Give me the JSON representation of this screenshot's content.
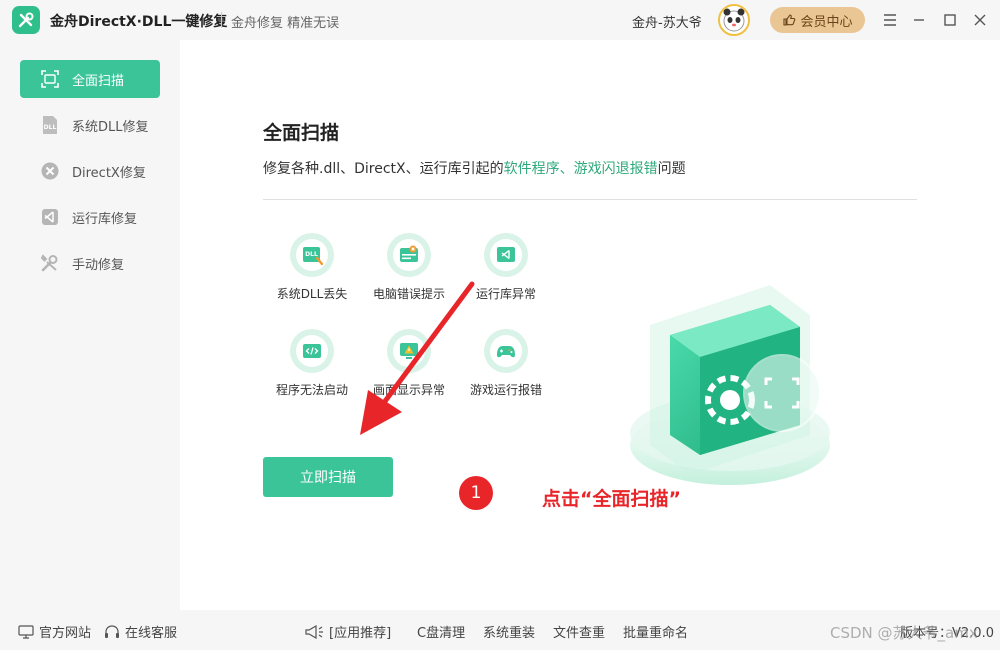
{
  "titlebar": {
    "app_title": "金舟DirectX·DLL一键修复",
    "slogan": "金舟修复 精准无误",
    "user_name": "金舟-苏大爷",
    "vip_label": "会员中心"
  },
  "sidebar": {
    "items": [
      {
        "label": "全面扫描",
        "icon": "scan-icon",
        "active": true
      },
      {
        "label": "系统DLL修复",
        "icon": "dll-icon",
        "active": false
      },
      {
        "label": "DirectX修复",
        "icon": "directx-icon",
        "active": false
      },
      {
        "label": "运行库修复",
        "icon": "runtime-icon",
        "active": false
      },
      {
        "label": "手动修复",
        "icon": "wrench-icon",
        "active": false
      }
    ]
  },
  "main": {
    "title": "全面扫描",
    "desc_prefix": "修复各种.dll、DirectX、运行库引起的",
    "desc_highlight": "软件程序、游戏闪退报错",
    "desc_suffix": "问题",
    "features": [
      {
        "label": "系统DLL丢失",
        "icon": "dll-file-icon"
      },
      {
        "label": "电脑错误提示",
        "icon": "error-window-icon"
      },
      {
        "label": "运行库异常",
        "icon": "runtime-window-icon"
      },
      {
        "label": "程序无法启动",
        "icon": "code-window-icon"
      },
      {
        "label": "画面显示异常",
        "icon": "warning-monitor-icon"
      },
      {
        "label": "游戏运行报错",
        "icon": "gamepad-icon"
      }
    ],
    "scan_button": "立即扫描"
  },
  "annotation": {
    "step_number": "1",
    "instruction": "点击“全面扫描”"
  },
  "bottombar": {
    "official_site": "官方网站",
    "online_service": "在线客服",
    "recommend": "[应用推荐]",
    "links": [
      "C盘清理",
      "系统重装",
      "文件查重",
      "批量重命名"
    ],
    "version": "版本号：V2.0.0",
    "watermark": "CSDN @苏大爷_amx"
  },
  "colors": {
    "accent": "#3ac497",
    "highlight_text": "#2fa97c",
    "annotation_red": "#e8262a",
    "vip_gold": "#e9c694"
  }
}
